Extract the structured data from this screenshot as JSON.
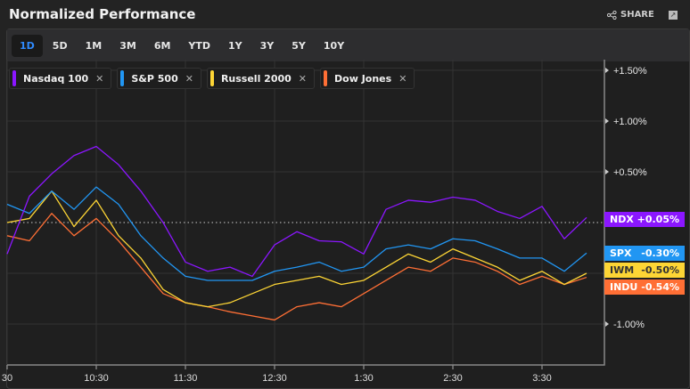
{
  "header": {
    "title": "Normalized Performance",
    "share_label": "SHARE",
    "share_icon": "share-icon",
    "expand_icon": "external-link-icon"
  },
  "ranges": [
    "1D",
    "5D",
    "1M",
    "3M",
    "6M",
    "YTD",
    "1Y",
    "3Y",
    "5Y",
    "10Y"
  ],
  "active_range": "1D",
  "legend": [
    {
      "label": "Nasdaq 100",
      "color": "#8b16ff"
    },
    {
      "label": "S&P 500",
      "color": "#2196f3"
    },
    {
      "label": "Russell 2000",
      "color": "#fdd535"
    },
    {
      "label": "Dow Jones",
      "color": "#ff6f35"
    }
  ],
  "chart_data": {
    "type": "line",
    "x": [
      "9:30",
      "9:45",
      "10:00",
      "10:15",
      "10:30",
      "10:45",
      "11:00",
      "11:15",
      "11:30",
      "11:45",
      "12:00",
      "12:15",
      "12:30",
      "12:45",
      "1:00",
      "1:15",
      "1:30",
      "1:45",
      "2:00",
      "2:15",
      "2:30",
      "2:45",
      "3:00",
      "3:15",
      "3:30",
      "3:45",
      "4:00"
    ],
    "xticks": [
      "30",
      "10:30",
      "11:30",
      "12:30",
      "1:30",
      "2:30",
      "3:30"
    ],
    "yticks": [
      "+1.50%",
      "+1.00%",
      "+0.50%",
      "-1.00%"
    ],
    "ylim": [
      -1.4,
      1.6
    ],
    "baseline": 0,
    "grid": true,
    "series": [
      {
        "name": "Nasdaq 100",
        "ticker": "NDX",
        "last": "+0.05%",
        "color": "#8b16ff",
        "values": [
          -0.31,
          0.26,
          0.48,
          0.66,
          0.75,
          0.57,
          0.31,
          0.0,
          -0.39,
          -0.48,
          -0.44,
          -0.53,
          -0.22,
          -0.09,
          -0.18,
          -0.19,
          -0.31,
          0.13,
          0.22,
          0.2,
          0.25,
          0.22,
          0.11,
          0.04,
          0.16,
          -0.16,
          0.05
        ]
      },
      {
        "name": "S&P 500",
        "ticker": "SPX",
        "last": "-0.30%",
        "color": "#2196f3",
        "values": [
          0.18,
          0.09,
          0.31,
          0.13,
          0.35,
          0.18,
          -0.13,
          -0.35,
          -0.53,
          -0.57,
          -0.57,
          -0.57,
          -0.48,
          -0.44,
          -0.39,
          -0.48,
          -0.44,
          -0.26,
          -0.22,
          -0.26,
          -0.16,
          -0.18,
          -0.26,
          -0.35,
          -0.35,
          -0.48,
          -0.3
        ]
      },
      {
        "name": "Russell 2000",
        "ticker": "IWM",
        "last": "-0.50%",
        "color": "#fdd535",
        "values": [
          0.0,
          0.04,
          0.31,
          -0.04,
          0.22,
          -0.13,
          -0.35,
          -0.66,
          -0.79,
          -0.83,
          -0.79,
          -0.7,
          -0.61,
          -0.57,
          -0.53,
          -0.61,
          -0.57,
          -0.44,
          -0.31,
          -0.39,
          -0.26,
          -0.35,
          -0.44,
          -0.57,
          -0.48,
          -0.61,
          -0.5
        ]
      },
      {
        "name": "Dow Jones",
        "ticker": "INDU",
        "last": "-0.54%",
        "color": "#ff6f35",
        "values": [
          -0.13,
          -0.18,
          0.09,
          -0.13,
          0.04,
          -0.18,
          -0.44,
          -0.7,
          -0.79,
          -0.83,
          -0.88,
          -0.92,
          -0.96,
          -0.83,
          -0.79,
          -0.83,
          -0.7,
          -0.57,
          -0.44,
          -0.48,
          -0.35,
          -0.39,
          -0.48,
          -0.61,
          -0.53,
          -0.61,
          -0.54
        ]
      }
    ]
  }
}
